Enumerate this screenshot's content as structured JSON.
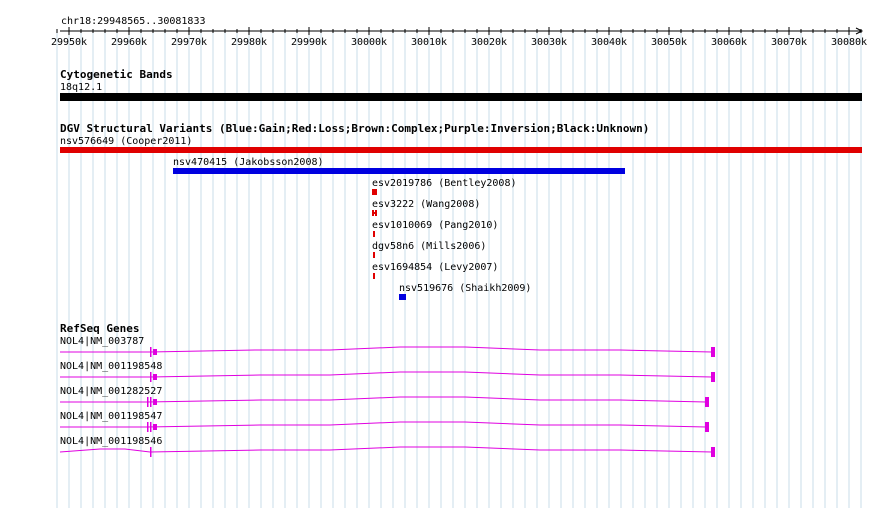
{
  "ruler": {
    "range_label": "chr18:29948565..30081833",
    "ticks": [
      "29950k",
      "29960k",
      "29970k",
      "29980k",
      "29990k",
      "30000k",
      "30010k",
      "30020k",
      "30030k",
      "30040k",
      "30050k",
      "30060k",
      "30070k",
      "30080k"
    ]
  },
  "cytobands": {
    "title": "Cytogenetic Bands",
    "band_label": "18q12.1"
  },
  "dgv": {
    "title": "DGV Structural Variants (Blue:Gain;Red:Loss;Brown:Complex;Purple:Inversion;Black:Unknown)",
    "colors": {
      "gain": "#0000e0",
      "loss": "#e00000"
    },
    "features": [
      {
        "label": "nsv576649 (Cooper2011)",
        "type": "loss"
      },
      {
        "label": "nsv470415 (Jakobsson2008)",
        "type": "gain"
      },
      {
        "label": "esv2019786 (Bentley2008)",
        "type": "loss"
      },
      {
        "label": "esv3222 (Wang2008)",
        "type": "loss"
      },
      {
        "label": "esv1010069 (Pang2010)",
        "type": "loss"
      },
      {
        "label": "dgv58n6 (Mills2006)",
        "type": "loss"
      },
      {
        "label": "esv1694854 (Levy2007)",
        "type": "loss"
      },
      {
        "label": "nsv519676 (Shaikh2009)",
        "type": "gain"
      }
    ]
  },
  "refseq": {
    "title": "RefSeq Genes",
    "color": "#e000e0",
    "transcripts": [
      "NOL4|NM_003787",
      "NOL4|NM_001198548",
      "NOL4|NM_001282527",
      "NOL4|NM_001198547",
      "NOL4|NM_001198546"
    ]
  }
}
